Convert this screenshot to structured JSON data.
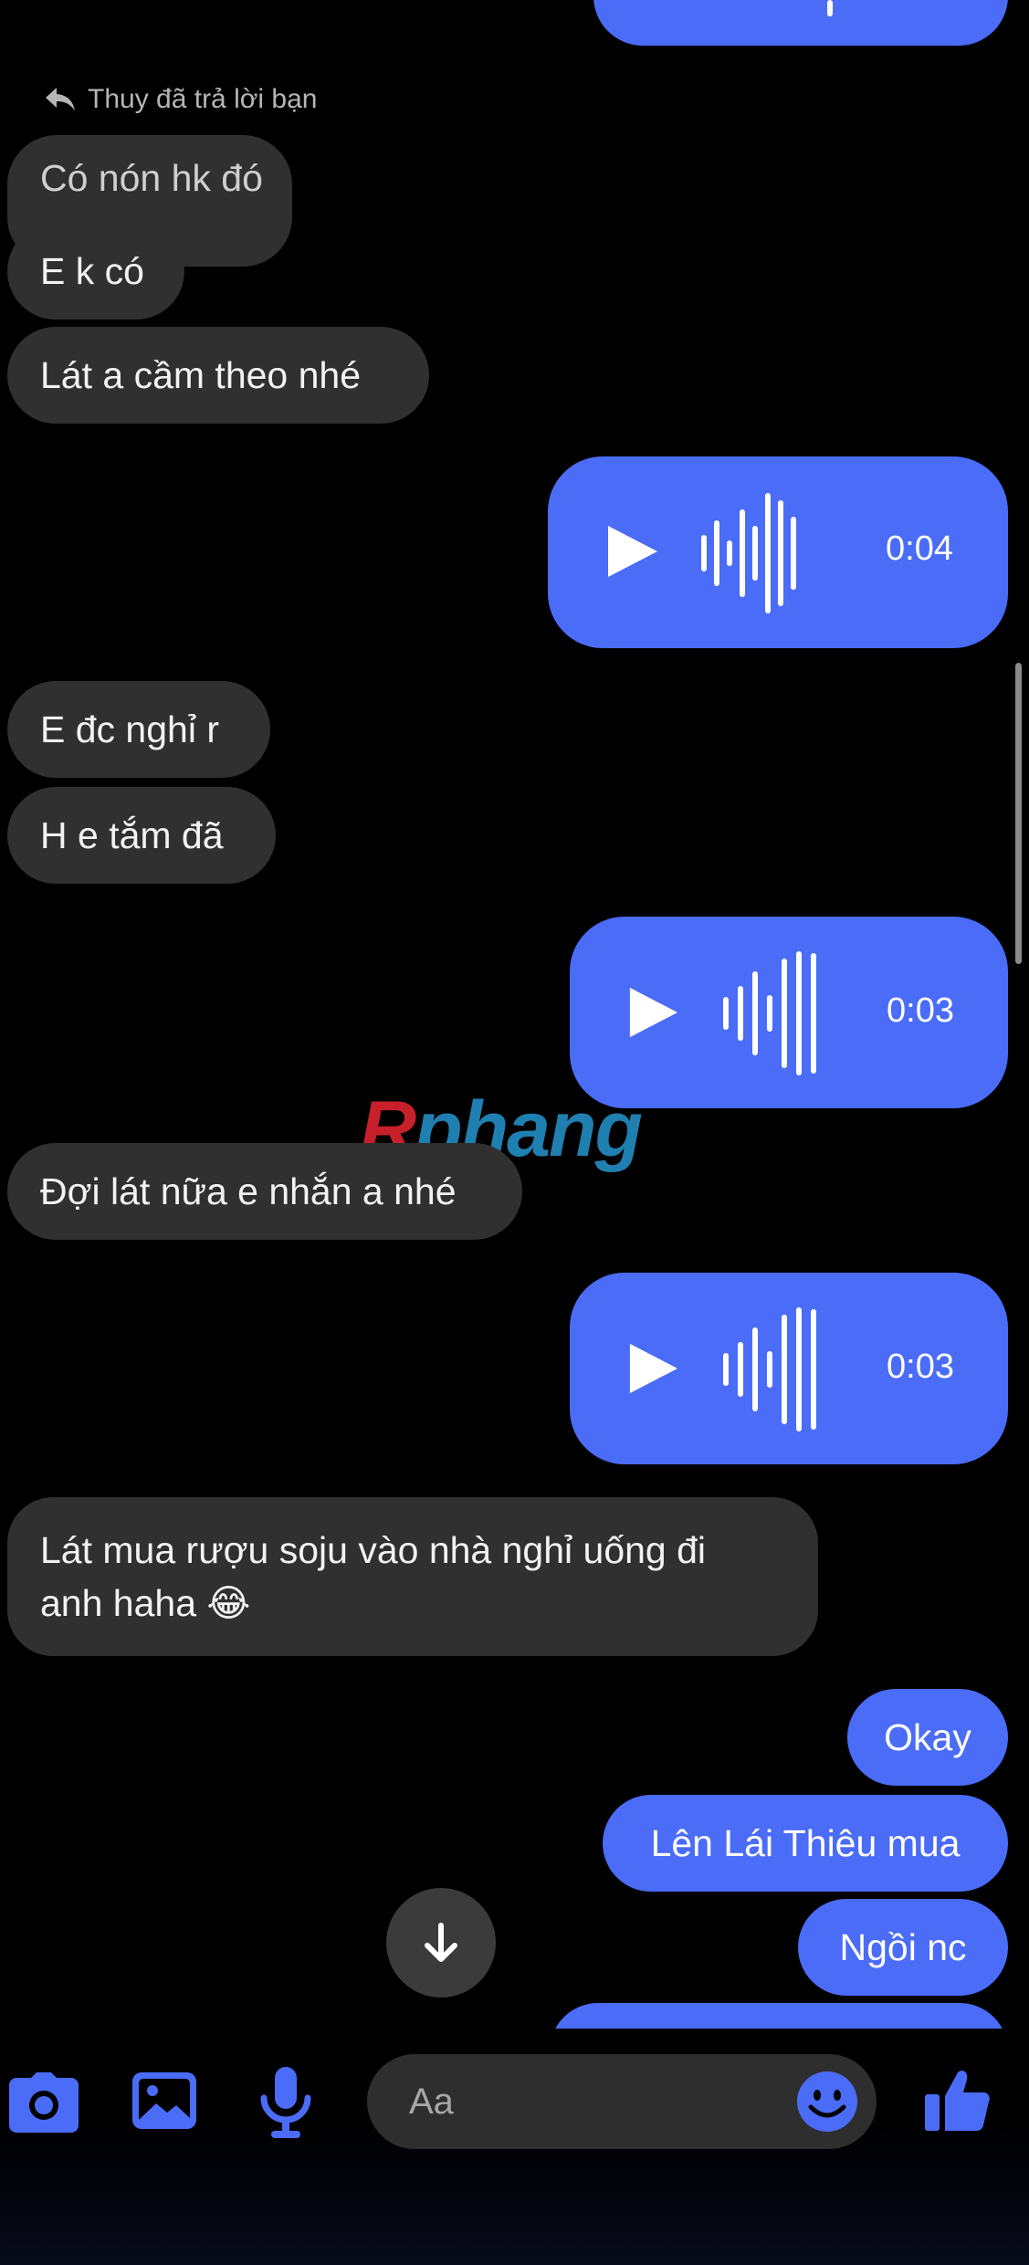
{
  "reply_label": "Thuy đã trả lời bạn",
  "messages": {
    "m1": "Có nón hk đó",
    "m2": "E k có",
    "m3": "Lát a cầm theo nhé",
    "v1": "0:04",
    "m4": "E đc nghỉ r",
    "m5": "H e tắm đã",
    "v2": "0:03",
    "m6": "Đợi lát nữa e nhắn a nhé",
    "v3": "0:03",
    "m7_line1": "Lát mua rượu soju vào nhà nghỉ uống đi",
    "m7_line2": "anh haha 😂",
    "o1": "Okay",
    "o2": "Lên Lái Thiêu mua",
    "o3": "Ngồi nc"
  },
  "watermark": {
    "part1": "R",
    "part2": "phang"
  },
  "composer": {
    "placeholder": "Aa"
  },
  "icons": [
    "camera-icon",
    "image-icon",
    "microphone-icon",
    "emoji-icon",
    "thumbs-up-icon",
    "arrow-down-icon",
    "reply-icon",
    "play-icon",
    "waveform-icon"
  ],
  "colors": {
    "accent": "#4a6cf7",
    "incoming_bubble": "#303030",
    "background": "#000000"
  }
}
